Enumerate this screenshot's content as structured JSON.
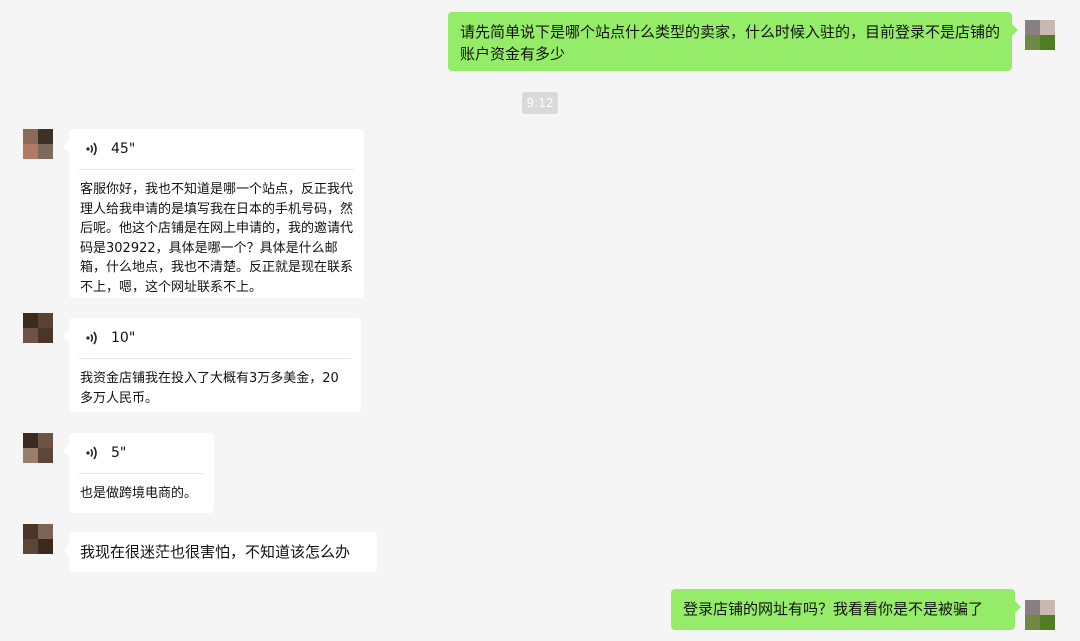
{
  "messages": {
    "m1": {
      "text": "请先简单说下是哪个站点什么类型的卖家，什么时候入驻的，目前登录不是店铺的账户资金有多少"
    },
    "timestamp": "9:12",
    "m2": {
      "duration": "45\"",
      "transcript": "客服你好，我也不知道是哪一个站点，反正我代理人给我申请的是填写我在日本的手机号码，然后呢。他这个店铺是在网上申请的，我的邀请代码是302922，具体是哪一个？具体是什么邮箱，什么地点，我也不清楚。反正就是现在联系不上，嗯，这个网址联系不上。"
    },
    "m3": {
      "duration": "10\"",
      "transcript": "我资金店铺我在投入了大概有3万多美金，20多万人民币。"
    },
    "m4": {
      "duration": "5\"",
      "transcript": "也是做跨境电商的。"
    },
    "m5": {
      "text": "我现在很迷茫也很害怕，不知道该怎么办"
    },
    "m6": {
      "text": "登录店铺的网址有吗？我看看你是不是被骗了"
    }
  },
  "colors": {
    "sent_bubble": "#95ec69",
    "received_bubble": "#ffffff",
    "background": "#f5f5f5"
  },
  "icons": {
    "voice": "voice-wave-icon",
    "avatar": "pixelated-avatar"
  }
}
